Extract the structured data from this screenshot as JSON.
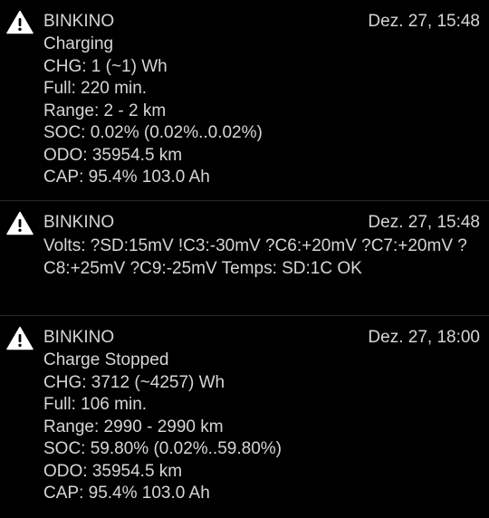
{
  "colors": {
    "background": "#000000",
    "text": "#d6d6d6",
    "divider": "#262626",
    "icon": "#ffffff"
  },
  "notifications": [
    {
      "icon": "warning-icon",
      "app": "BINKINO",
      "time": "Dez. 27, 15:48",
      "lines": [
        "Charging",
        "CHG: 1 (~1) Wh",
        "Full: 220 min.",
        "Range: 2 - 2 km",
        "SOC: 0.02% (0.02%..0.02%)",
        "ODO: 35954.5 km",
        "CAP: 95.4% 103.0 Ah"
      ]
    },
    {
      "icon": "warning-icon",
      "app": "BINKINO",
      "time": "Dez. 27, 15:48",
      "text": "Volts: ?SD:15mV !C3:-30mV ?C6:+20mV ?C7:+20mV ?C8:+25mV ?C9:-25mV Temps: SD:1C OK"
    },
    {
      "icon": "warning-icon",
      "app": "BINKINO",
      "time": "Dez. 27, 18:00",
      "lines": [
        "Charge Stopped",
        "CHG: 3712 (~4257) Wh",
        "Full: 106 min.",
        "Range: 2990 - 2990 km",
        "SOC: 59.80% (0.02%..59.80%)",
        "ODO: 35954.5 km",
        "CAP: 95.4% 103.0 Ah"
      ]
    }
  ]
}
